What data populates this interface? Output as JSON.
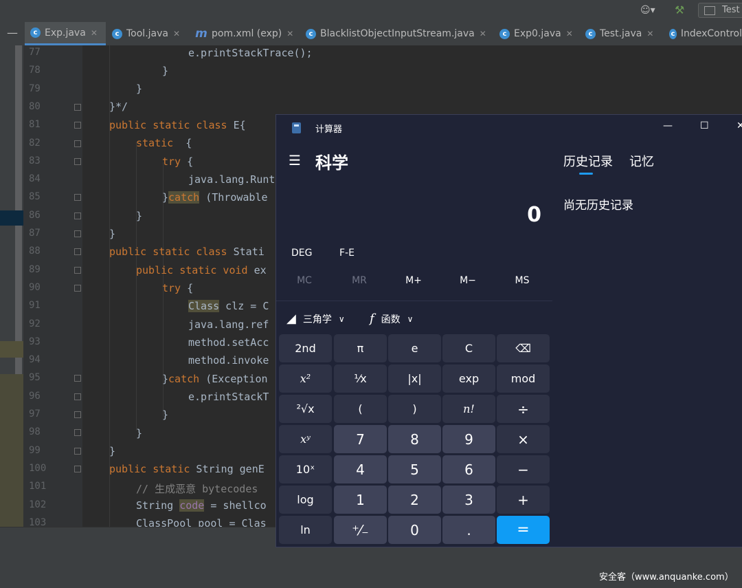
{
  "ide": {
    "run_config": "Test",
    "tabs": [
      {
        "label": "Exp.java",
        "icon": "c"
      },
      {
        "label": "Tool.java",
        "icon": "c"
      },
      {
        "label": "pom.xml (exp)",
        "icon": "m"
      },
      {
        "label": "BlacklistObjectInputStream.java",
        "icon": "c"
      },
      {
        "label": "Exp0.java",
        "icon": "c"
      },
      {
        "label": "Test.java",
        "icon": "c"
      },
      {
        "label": "IndexControl",
        "icon": "c"
      }
    ],
    "line_numbers": [
      "77",
      "78",
      "79",
      "80",
      "81",
      "82",
      "83",
      "84",
      "85",
      "86",
      "87",
      "88",
      "89",
      "90",
      "91",
      "92",
      "93",
      "94",
      "95",
      "96",
      "97",
      "98",
      "99",
      "100",
      "101",
      "102",
      "103"
    ],
    "code": {
      "l77": "e.printStackTrace();",
      "l78": "}",
      "l79": "}",
      "l80": "}*/",
      "l81_kw": "public static class",
      "l81_rest": " E{",
      "l82_kw": "static",
      "l82_rest": "  {",
      "l83_kw": "try",
      "l83_rest": " {",
      "l84": "java.lang.Runt",
      "l85_open": "}",
      "l85_kw": "catch",
      "l85_rest": " (Throwable",
      "l86": "}",
      "l87": "}",
      "l88_kw": "public static class",
      "l88_rest": " Stati",
      "l89_kw": "public static void",
      "l89_rest": " ex",
      "l90_kw": "try",
      "l90_rest": " {",
      "l91_hl": "Class",
      "l91_rest": " clz = C",
      "l92": "java.lang.ref",
      "l93": "method.setAcc",
      "l94": "method.invoke",
      "l95_open": "}",
      "l95_kw": "catch",
      "l95_rest": " (Exception",
      "l96": "e.printStackT",
      "l97": "}",
      "l98": "}",
      "l99": "}",
      "l100_kw": "public static",
      "l100_rest": " String genE",
      "l101": "// 生成恶意 bytecodes",
      "l102_pre": "String ",
      "l102_hl": "code",
      "l102_rest": " = shellco",
      "l103": "ClassPool pool = Clas"
    }
  },
  "calculator": {
    "title": "计算器",
    "mode": "科学",
    "display": "0",
    "angle_mode": "DEG",
    "fe": "F-E",
    "memory": [
      "MC",
      "MR",
      "M+",
      "M−",
      "MS"
    ],
    "trig_label": "三角学",
    "func_label": "函数",
    "history_tab": "历史记录",
    "memory_tab": "记忆",
    "history_empty": "尚无历史记录",
    "keys": [
      [
        "2nd",
        "π",
        "e",
        "C",
        "⌫"
      ],
      [
        "x²",
        "¹⁄x",
        "|x|",
        "exp",
        "mod"
      ],
      [
        "²√x",
        "(",
        ")",
        "n!",
        "÷"
      ],
      [
        "xʸ",
        "7",
        "8",
        "9",
        "×"
      ],
      [
        "10ˣ",
        "4",
        "5",
        "6",
        "−"
      ],
      [
        "log",
        "1",
        "2",
        "3",
        "+"
      ],
      [
        "ln",
        "⁺⁄₋",
        "0",
        ".",
        "="
      ]
    ],
    "accent_color": "#0f9cf5"
  },
  "watermark": "安全客（www.anquanke.com）"
}
